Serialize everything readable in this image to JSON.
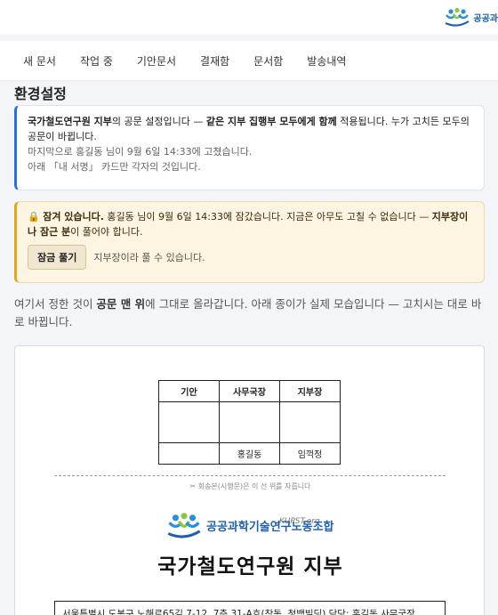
{
  "header": {
    "logo_text": "공공과",
    "logo_icon": "union-people-logo-icon"
  },
  "nav": {
    "items": [
      "새 문서",
      "작업 중",
      "기안문서",
      "결재함",
      "문서함",
      "발송내역"
    ]
  },
  "page": {
    "title": "환경설정"
  },
  "info": {
    "p1_org": "국가철도연구원 지부",
    "p1_mid": "의 공문 설정입니다 — ",
    "p1_bold": "같은 지부 집행부 모두에게 함께",
    "p1_end": " 적용됩니다. 누가 고치든 모두의 공문이 바뀝니다.",
    "p2": "마지막으로 홍길동 님이 9월 6일 14:33에 고쳤습니다.",
    "p3": "아래 「내 서명」 카드만 각자의 것입니다."
  },
  "lock": {
    "icon": "lock-icon",
    "title": "잠겨 있습니다.",
    "text1": " 홍길동 님이 9월 6일 14:33에 잠갔습니다. 지금은 아무도 고칠 수 없습니다 — ",
    "bold2": "지부장이나 잠근 분",
    "text2": "이 풀어야 합니다.",
    "button": "잠금 풀기",
    "note": "지부장이라 풀 수 있습니다."
  },
  "desc": {
    "t1": "여기서 정한 것이 ",
    "b1": "공문 맨 위",
    "t2": "에 그대로 올라갑니다. 아래 종이가 실제 모습입니다 — 고치시는 대로 바로 바뀝니다."
  },
  "preview": {
    "approval_headers": [
      "기안",
      "사무국장",
      "지부장"
    ],
    "approval_names": [
      "",
      "홍길동",
      "임꺽정"
    ],
    "cut_note": "✂ 회송본(시행문)은 이 선 위를 자릅니다",
    "kupst": "KUPST.org",
    "union_name": "공공과학기술연구노동조합",
    "branch_name": "국가철도연구원 지부",
    "address": "서울특별시 도봉구 노해로65길 7-12, 7층 31-A호(창동, 청백빌딩) 담당: 홍길동 사무국장"
  },
  "colors": {
    "accent": "#2f6fd3",
    "warning_bg": "#fdf4e1",
    "warning_border": "#e0a526",
    "logo_blue": "#1f5fae"
  }
}
